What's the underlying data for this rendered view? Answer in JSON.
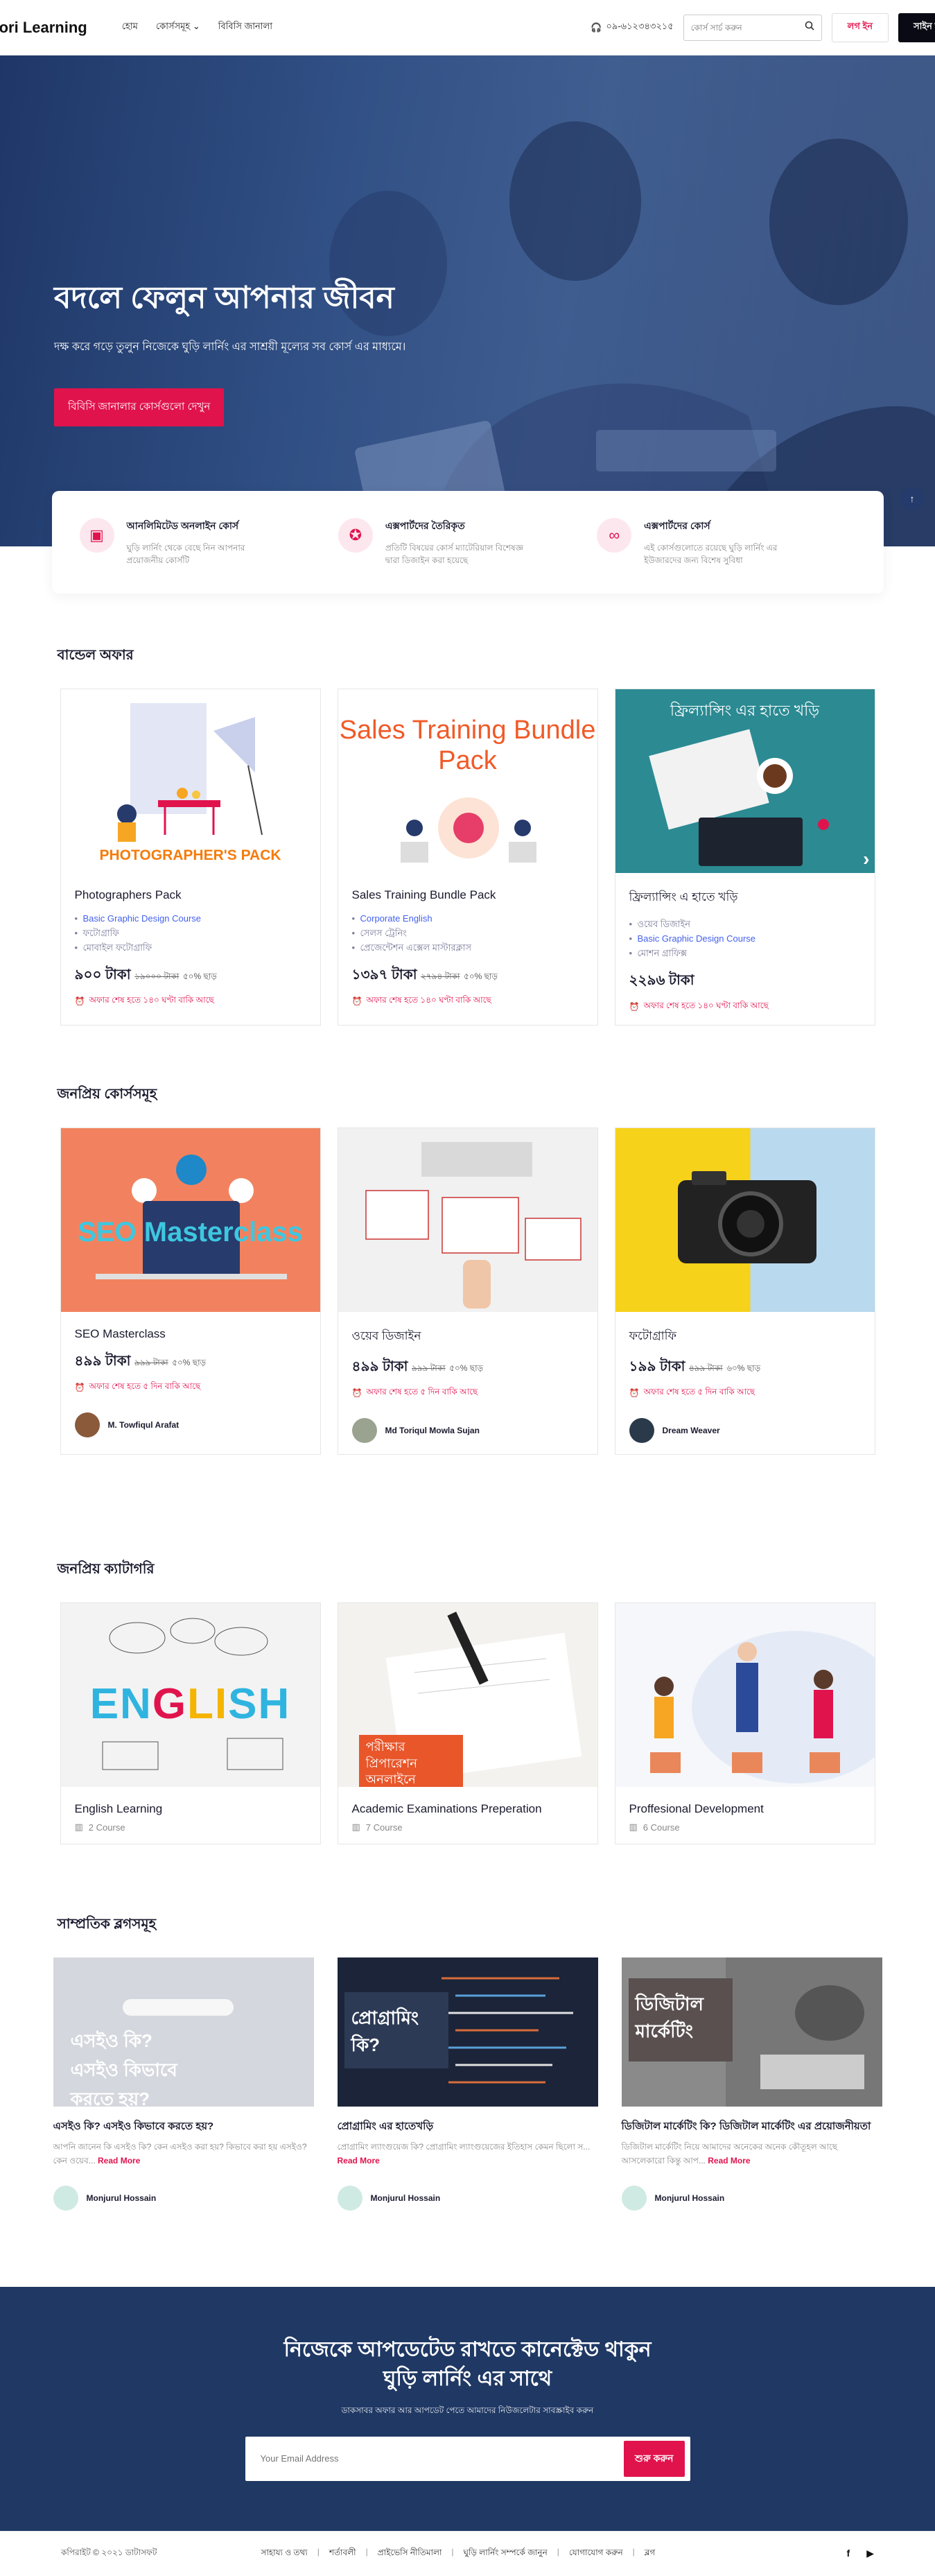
{
  "header": {
    "logo": "ghoori Learning",
    "nav": [
      "হোম",
      "কোর্সসমূহ",
      "বিবিসি জানালা"
    ],
    "phone": "০৯-৬১২৩৪৩২১৫",
    "search_placeholder": "কোর্স সার্চ করুন",
    "login": "লগ ইন",
    "signup": "সাইন আপ"
  },
  "hero": {
    "title": "বদলে ফেলুন আপনার জীবন",
    "subtitle": "দক্ষ করে গড়ে তুলুন নিজেকে ঘুড়ি লার্নিং এর সাশ্রয়ী মূল্যের সব কোর্স এর মাধ্যমে।",
    "button": "বিবিসি জানালার কোর্সগুলো দেখুন"
  },
  "features": [
    {
      "icon": "video-icon",
      "title": "আনলিমিটেড অনলাইন কোর্স",
      "text": "ঘুড়ি লার্নিং থেকে বেছে নিন আপনার প্রয়োজনীয় কোর্সটি"
    },
    {
      "icon": "badge-icon",
      "title": "এক্সপার্টদের তৈরিকৃত",
      "text": "প্রতিটি বিষয়ের কোর্স ম্যাটেরিয়াল বিশেষজ্ঞ দ্বারা ডিজাইন করা হয়েছে"
    },
    {
      "icon": "infinity-icon",
      "title": "এক্সপার্টদের কোর্স",
      "text": "এই কোর্সগুলোতে রয়েছে ঘুড়ি লার্নিং এর ইউজারদের জন্য বিশেষ সুবিধা"
    }
  ],
  "bundle": {
    "title": "বান্ডেল অফার",
    "items": [
      {
        "title": "Photographers Pack",
        "image_text": "PHOTOGRAPHER'S PACK",
        "bullets": [
          "Basic Graphic Design Course",
          "ফটোগ্রাফি",
          "মোবাইল ফটোগ্রাফি"
        ],
        "price": "৯০০ টাকা",
        "old": "১৯০০০ টাকা",
        "off": "৫০% ছাড়",
        "timer": "অফার শেষ হতে ১৪০ ঘণ্টা বাকি আছে"
      },
      {
        "title": "Sales Training Bundle Pack",
        "image_text": "Sales Training Bundle Pack",
        "bullets": [
          "Corporate English",
          "সেলস ট্রেনিং",
          "প্রেজেন্টেশন এক্সেল মাস্টারক্লাস"
        ],
        "price": "১৩৯৭ টাকা",
        "old": "২৭৯৪ টাকা",
        "off": "৫০% ছাড়",
        "timer": "অফার শেষ হতে ১৪০ ঘণ্টা বাকি আছে"
      },
      {
        "title": "ফ্রিল্যান্সিং এ হাতে খড়ি",
        "image_text": "ফ্রিল্যান্সিং এর হাতে খড়ি",
        "bullets": [
          "ওয়েব ডিজাইন",
          "Basic Graphic Design Course",
          "মোশন গ্রাফিক্স"
        ],
        "price": "২২৯৬ টাকা",
        "old": "",
        "off": "",
        "timer": "অফার শেষ হতে ১৪০ ঘণ্টা বাকি আছে"
      }
    ]
  },
  "popular_courses": {
    "title": "জনপ্রিয় কোর্সসমূহ",
    "items": [
      {
        "title": "SEO Masterclass",
        "price": "৪৯৯ টাকা",
        "old": "৯৯৯ টাকা",
        "off": "৫০% ছাড়",
        "timer": "অফার শেষ হতে ৫ দিন বাকি আছে",
        "instructor": "M. Towfiqul Arafat"
      },
      {
        "title": "ওয়েব ডিজাইন",
        "price": "৪৯৯ টাকা",
        "old": "৯৯৯ টাকা",
        "off": "৫০% ছাড়",
        "timer": "অফার শেষ হতে ৫ দিন বাকি আছে",
        "instructor": "Md Toriqul Mowla Sujan"
      },
      {
        "title": "ফটোগ্রাফি",
        "price": "১৯৯ টাকা",
        "old": "৪৯৯ টাকা",
        "off": "৬০% ছাড়",
        "timer": "অফার শেষ হতে ৫ দিন বাকি আছে",
        "instructor": "Dream Weaver"
      }
    ]
  },
  "categories": {
    "title": "জনপ্রিয় ক্যাটাগরি",
    "items": [
      {
        "title": "English Learning",
        "count": "2 Course"
      },
      {
        "title": "Academic Examinations Preperation",
        "count": "7 Course",
        "image_text": "পরীক্ষার প্রিপারেশন অনলাইনে"
      },
      {
        "title": "Proffesional Development",
        "count": "6 Course"
      }
    ]
  },
  "blogs": {
    "title": "সাম্প্রতিক ব্লগসমূহ",
    "items": [
      {
        "image_text": "এসইও কি? এসইও কিভাবে করতে হয়?",
        "title": "এসইও কি? এসইও কিভাবে করতে হয়?",
        "excerpt": "আপনি জানেন কি এসইও কি? কেন এসইও করা হয়? কিভাবে করা হয় এসইও? কেন ওয়েব...",
        "more": "Read More",
        "author": "Monjurul Hossain"
      },
      {
        "image_text": "প্রোগ্রামিং কি?",
        "title": "প্রোগ্রামিং এর হাতেখড়ি",
        "excerpt": "প্রোগ্রামিং ল্যাংগুয়েজ কি? প্রোগ্রামিং ল্যাংগুয়েজের ইতিহাস কেমন ছিলো স...",
        "more": "Read More",
        "author": "Monjurul Hossain"
      },
      {
        "image_text": "ডিজিটাল মার্কেটিং",
        "title": "ডিজিটাল মার্কেটিং কি? ডিজিটাল মার্কেটিং এর প্রয়োজনীয়তা",
        "excerpt": "ডিজিটাল মার্কেটিং নিয়ে আমাদের অনেকের অনেক কৌতূহল আছে আসলেকারো কিন্তু আপ...",
        "more": "Read More",
        "author": "Monjurul Hossain"
      }
    ]
  },
  "newsletter": {
    "title_line1": "নিজেকে আপডেটেড রাখতে কানেক্টেড থাকুন",
    "title_line2": "ঘুড়ি লার্নিং এর সাথে",
    "subtitle": "ডাকসাবর অফার আর আপডেট পেতে আমাদের নিউজলেটার সাবস্ক্রাইব করুন",
    "placeholder": "Your Email Address",
    "button": "শুরু করুন"
  },
  "footer": {
    "copyright": "কপিরাইট © ২০২১ ডাটাসফট",
    "links": [
      "সাহায্য ও তথ্য",
      "শর্তাবলী",
      "প্রাইভেসি নীতিমালা",
      "ঘুড়ি লার্নিং সম্পর্কে জানুন",
      "যোগাযোগ করুন",
      "ব্লগ"
    ],
    "social": [
      "f",
      "▶"
    ]
  },
  "colors": {
    "accent": "#e0134d",
    "navy": "#1f3864"
  }
}
